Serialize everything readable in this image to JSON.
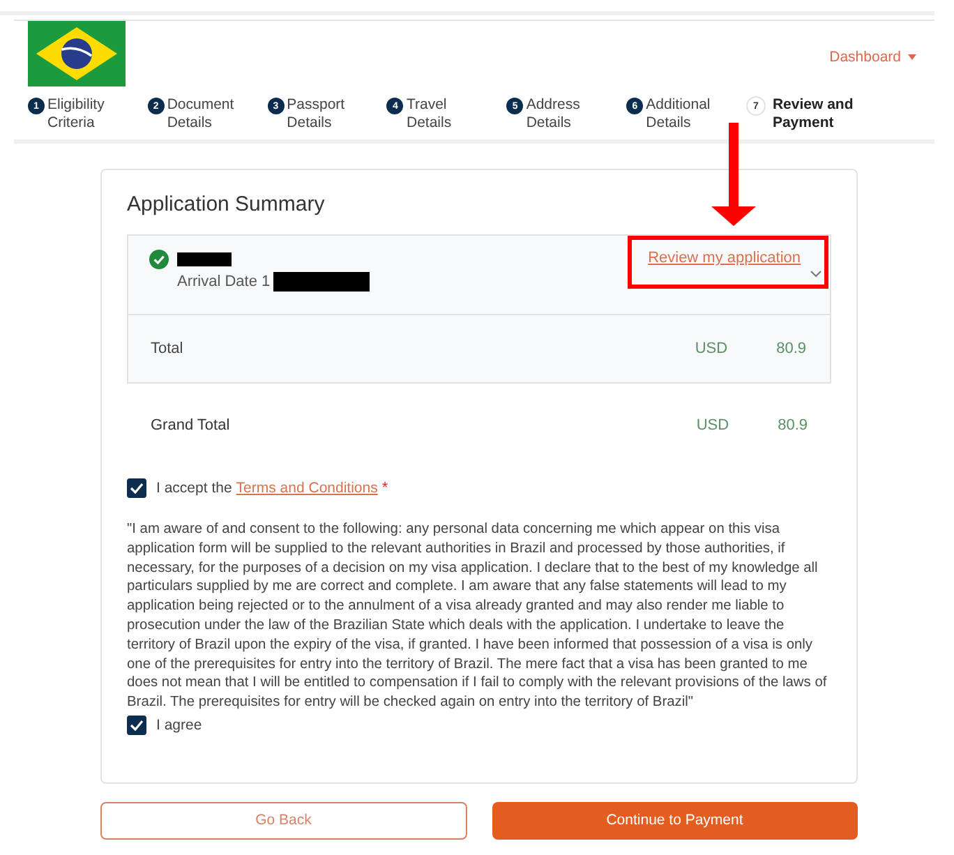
{
  "header": {
    "dashboard": "Dashboard"
  },
  "steps": [
    {
      "number": "1",
      "label": "Eligibility Criteria",
      "selected": false
    },
    {
      "number": "2",
      "label": "Document Details",
      "selected": false
    },
    {
      "number": "3",
      "label": "Passport Details",
      "selected": false
    },
    {
      "number": "4",
      "label": "Travel Details",
      "selected": false
    },
    {
      "number": "5",
      "label": "Address Details",
      "selected": false
    },
    {
      "number": "6",
      "label": "Additional Details",
      "selected": false
    },
    {
      "number": "7",
      "label": "Review and Payment",
      "selected": true
    }
  ],
  "summary": {
    "title": "Application Summary",
    "application": {
      "complete": true,
      "arrival_label": "Arrival Date 1",
      "review_link": {
        "label": "Review my application",
        "highlighted": true
      },
      "expanded": false
    },
    "total": {
      "label": "Total",
      "currency": "USD",
      "amount": "80.9"
    },
    "grand_total": {
      "label": "Grand Total",
      "currency": "USD",
      "amount": "80.9"
    }
  },
  "terms": {
    "checked": true,
    "prefix": "I accept the",
    "link": "Terms and Conditions",
    "required_mark": "*"
  },
  "declaration": "\"I am aware of and consent to the following: any personal data concerning me which appear on this visa application form will be supplied to the relevant authorities in Brazil and processed by those authorities, if necessary, for the purposes of a decision on my visa application. I declare that to the best of my knowledge all particulars supplied by me are correct and complete. I am aware that any false statements will lead to my application being rejected or to the annulment of a visa already granted and may also render me liable to prosecution under the law of the Brazilian State which deals with the application. I undertake to leave the territory of Brazil upon the expiry of the visa, if granted. I have been informed that possession of a visa is only one of the prerequisites for entry into the territory of Brazil. The mere fact that a visa has been granted to me does not mean that I will be entitled to compensation if I fail to comply with the relevant provisions of the laws of Brazil. The prerequisites for entry will be checked again on entry into the territory of Brazil\"",
  "agree": {
    "checked": true,
    "label": "I agree"
  },
  "buttons": [
    {
      "label": "Go Back",
      "kind": "outline"
    },
    {
      "label": "Continue to Payment",
      "kind": "primary"
    }
  ]
}
